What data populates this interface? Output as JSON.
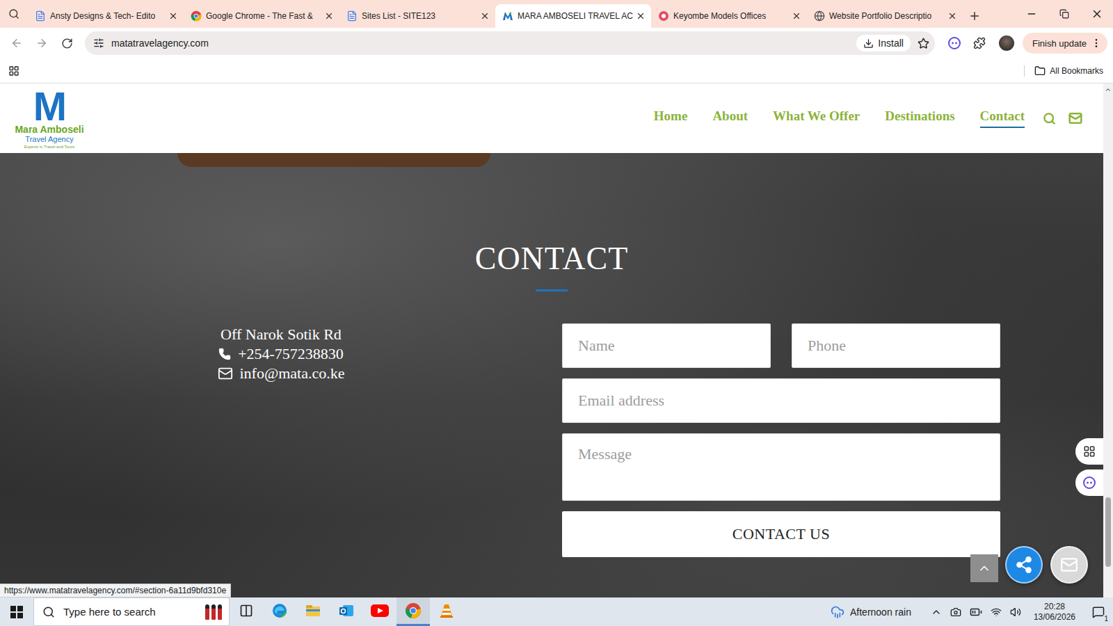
{
  "browser": {
    "tabs": [
      {
        "label": "Ansty Designs & Tech- Edito",
        "selected": false,
        "kind": "docs"
      },
      {
        "label": "Google Chrome - The Fast &",
        "selected": false,
        "kind": "chrome"
      },
      {
        "label": "Sites List - SITE123",
        "selected": false,
        "kind": "docs"
      },
      {
        "label": "MARA AMBOSELI TRAVEL AC",
        "selected": true,
        "kind": "site"
      },
      {
        "label": "Keyombe Models Offices",
        "selected": false,
        "kind": "models"
      },
      {
        "label": "Website Portfolio Descriptio",
        "selected": false,
        "kind": "globe"
      }
    ],
    "address": "matatravelagency.com",
    "install": "Install",
    "update": "Finish update",
    "bookmarks": "All Bookmarks",
    "status_url": "https://www.matatravelagency.com/#section-6a11d9bfd310e"
  },
  "site": {
    "logo": {
      "mark": "M",
      "name": "Mara Amboseli",
      "sub": "Travel Agency",
      "tagline": "Experts in Travel and Tours"
    },
    "nav": [
      {
        "label": "Home",
        "selected": false
      },
      {
        "label": "About",
        "selected": false
      },
      {
        "label": "What We Offer",
        "selected": false
      },
      {
        "label": "Destinations",
        "selected": false
      },
      {
        "label": "Contact",
        "selected": true
      }
    ],
    "contact": {
      "title": "CONTACT",
      "address": "Off Narok Sotik Rd",
      "phone": "+254-757238830",
      "email": "info@mata.co.ke",
      "fields": [
        {
          "placeholder": "Name",
          "kind": "short"
        },
        {
          "placeholder": "Phone",
          "kind": "short"
        },
        {
          "placeholder": "Email address",
          "kind": "wide"
        },
        {
          "placeholder": "Message",
          "kind": "area"
        }
      ],
      "button": "CONTACT US"
    }
  },
  "taskbar": {
    "search": "Type here to search",
    "apps": [
      {
        "kind": "taskview",
        "active": false
      },
      {
        "kind": "edge",
        "active": false
      },
      {
        "kind": "explorer",
        "active": false
      },
      {
        "kind": "outlook",
        "active": false
      },
      {
        "kind": "youtube",
        "active": false
      },
      {
        "kind": "chrome",
        "active": true
      },
      {
        "kind": "vlc",
        "active": false
      }
    ],
    "weather": "Afternoon rain",
    "time": "20:28",
    "date": "13/06/2026",
    "notifications": "1"
  }
}
